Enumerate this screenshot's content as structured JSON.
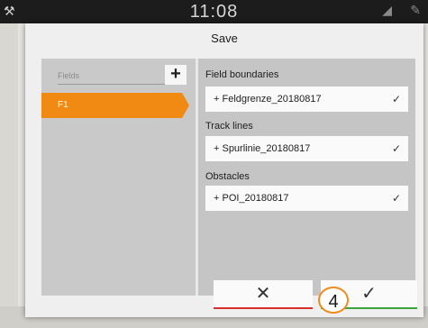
{
  "status_bar": {
    "time": "11:08",
    "icons": [
      "wrench-icon",
      "signal-icon",
      "pen-icon"
    ]
  },
  "dialog": {
    "title": "Save",
    "fields_panel": {
      "label": "Fields",
      "add_icon": "+",
      "items": [
        {
          "label": "F1",
          "selected": true
        }
      ]
    },
    "sections": [
      {
        "label": "Field boundaries",
        "entry": "+ Feldgrenze_20180817",
        "check": "✓"
      },
      {
        "label": "Track lines",
        "entry": "+ Spurlinie_20180817",
        "check": "✓"
      },
      {
        "label": "Obstacles",
        "entry": "+ POI_20180817",
        "check": "✓"
      }
    ],
    "cancel_icon": "✕",
    "confirm_icon": "✓",
    "callout_number": "4"
  },
  "colors": {
    "accent": "#f18a12",
    "cancel_underline": "#d7302a",
    "confirm_underline": "#3aa53c"
  }
}
